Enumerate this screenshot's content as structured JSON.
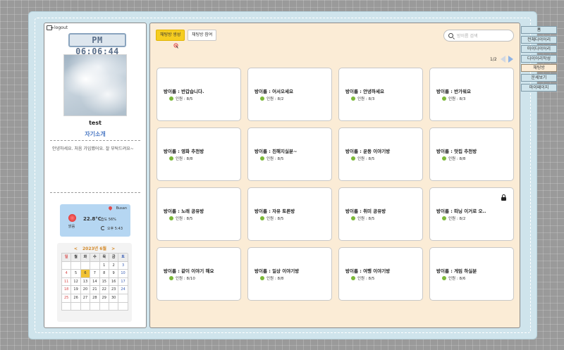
{
  "profile": {
    "logout_label": "logout",
    "clock": "PM 06:06:44",
    "username": "test",
    "intro_title": "자기소개",
    "intro_text": "안녕하세요. 처음 가입했어요. 잘 부탁드려요~",
    "weather": {
      "location": "Busan",
      "temperature": "22.8°C",
      "humidity": "습도 56%",
      "condition": "맑음",
      "updated": "오후 5:43",
      "icon": "sun-icon",
      "accent": "#b5d6f2"
    },
    "calendar": {
      "title": "2023년 6월",
      "prev": "<",
      "next": ">",
      "weekdays": [
        "일",
        "월",
        "화",
        "수",
        "목",
        "금",
        "토"
      ],
      "weeks": [
        [
          "",
          "",
          "",
          "",
          "1",
          "2",
          "3"
        ],
        [
          "4",
          "5",
          "6",
          "7",
          "8",
          "9",
          "10"
        ],
        [
          "11",
          "12",
          "13",
          "14",
          "15",
          "16",
          "17"
        ],
        [
          "18",
          "19",
          "20",
          "21",
          "22",
          "23",
          "24"
        ],
        [
          "25",
          "26",
          "27",
          "28",
          "29",
          "30",
          ""
        ],
        [
          "",
          "",
          "",
          "",
          "",
          "",
          ""
        ]
      ],
      "today": "6",
      "today_color": "#f1c232"
    }
  },
  "main": {
    "tabs": [
      {
        "label": "채팅방 생성",
        "active": true
      },
      {
        "label": "채팅방 참여",
        "active": false
      }
    ],
    "search": {
      "placeholder": "방이름 검색",
      "value": ""
    },
    "pager": "1/2",
    "rooms": [
      {
        "name": "방이름 : 반갑습니다.",
        "count": "인원 : 8/5",
        "locked": false
      },
      {
        "name": "방이름 : 어서오세요",
        "count": "인원 : 8/2",
        "locked": false
      },
      {
        "name": "방이름 : 안녕하세요",
        "count": "인원 : 8/3",
        "locked": false
      },
      {
        "name": "방이름 : 반가워요",
        "count": "인원 : 8/3",
        "locked": false
      },
      {
        "name": "방이름 : 영화 추천방",
        "count": "인원 : 8/8",
        "locked": false
      },
      {
        "name": "방이름 : 친해지실분~",
        "count": "인원 : 8/5",
        "locked": false
      },
      {
        "name": "방이름 : 운동 이야기방",
        "count": "인원 : 8/5",
        "locked": false
      },
      {
        "name": "방이름 : 맛집 추천방",
        "count": "인원 : 8/8",
        "locked": false
      },
      {
        "name": "방이름 : 노래 공유방",
        "count": "인원 : 8/5",
        "locked": false
      },
      {
        "name": "방이름 : 자유 토론방",
        "count": "인원 : 8/5",
        "locked": false
      },
      {
        "name": "방이름 : 취미 공유방",
        "count": "인원 : 8/5",
        "locked": false
      },
      {
        "name": "방이름 : 떠닝 이거로 오..",
        "count": "인원 : 8/2",
        "locked": true
      },
      {
        "name": "방이름 : 같이 이야기 해요",
        "count": "인원 : 8/10",
        "locked": false
      },
      {
        "name": "방이름 : 일상 이야기방",
        "count": "인원 : 8/8",
        "locked": false
      },
      {
        "name": "방이름 : 여행 이야기방",
        "count": "인원 : 8/5",
        "locked": false
      },
      {
        "name": "방이름 : 게임 하실분",
        "count": "인원 : 8/6",
        "locked": false
      }
    ],
    "colors": {
      "background": "#fbecd6",
      "active_tab": "#f6cd20",
      "online_dot": "#7cb83a"
    }
  },
  "side_menu": [
    {
      "label": "홈",
      "active": false
    },
    {
      "label": "전체다이어리",
      "active": false
    },
    {
      "label": "마이다이어리",
      "active": false
    },
    {
      "label": "다이어리작성",
      "active": false
    },
    {
      "label": "채팅방",
      "active": true
    },
    {
      "label": "운세보기",
      "active": false
    },
    {
      "label": "마이페이지",
      "active": false
    }
  ]
}
